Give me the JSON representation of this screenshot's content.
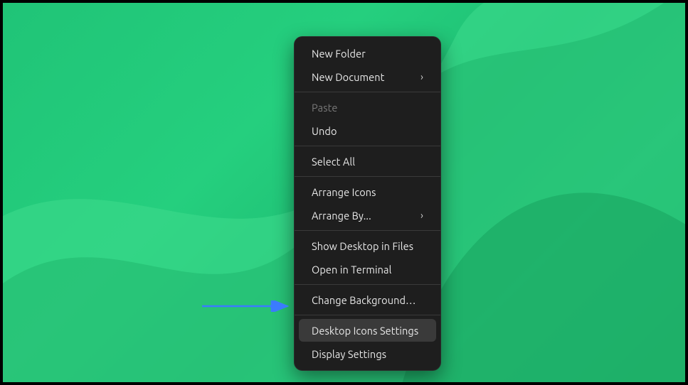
{
  "menu": {
    "items": [
      {
        "label": "New Folder",
        "disabled": false,
        "submenu": false,
        "highlight": false
      },
      {
        "label": "New Document",
        "disabled": false,
        "submenu": true,
        "highlight": false
      },
      {
        "separator": true
      },
      {
        "label": "Paste",
        "disabled": true,
        "submenu": false,
        "highlight": false
      },
      {
        "label": "Undo",
        "disabled": false,
        "submenu": false,
        "highlight": false
      },
      {
        "separator": true
      },
      {
        "label": "Select All",
        "disabled": false,
        "submenu": false,
        "highlight": false
      },
      {
        "separator": true
      },
      {
        "label": "Arrange Icons",
        "disabled": false,
        "submenu": false,
        "highlight": false
      },
      {
        "label": "Arrange By...",
        "disabled": false,
        "submenu": true,
        "highlight": false
      },
      {
        "separator": true
      },
      {
        "label": "Show Desktop in Files",
        "disabled": false,
        "submenu": false,
        "highlight": false
      },
      {
        "label": "Open in Terminal",
        "disabled": false,
        "submenu": false,
        "highlight": false
      },
      {
        "separator": true
      },
      {
        "label": "Change Background…",
        "disabled": false,
        "submenu": false,
        "highlight": false
      },
      {
        "separator": true
      },
      {
        "label": "Desktop Icons Settings",
        "disabled": false,
        "submenu": false,
        "highlight": true
      },
      {
        "label": "Display Settings",
        "disabled": false,
        "submenu": false,
        "highlight": false
      }
    ]
  },
  "colors": {
    "arrow": "#3b7bff"
  }
}
